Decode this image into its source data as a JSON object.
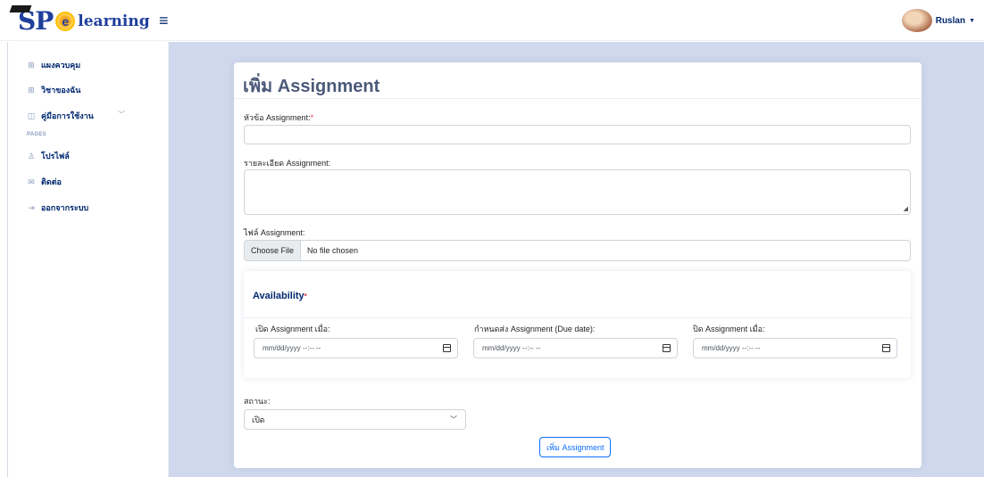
{
  "header": {
    "logo": {
      "sp": "SP",
      "sun": "e",
      "text": "learning"
    },
    "toggle_icon": "≡",
    "user_name": "Ruslan"
  },
  "sidebar": {
    "items": [
      {
        "label": "แผงควบคุม",
        "icon": "grid-icon"
      },
      {
        "label": "วิชาของฉัน",
        "icon": "grid-icon"
      },
      {
        "label": "คู่มือการใช้งาน",
        "icon": "book-icon",
        "has_chevron": true
      }
    ],
    "heading": "PAGES",
    "pages": [
      {
        "label": "โปรไฟล์",
        "icon": "person-icon"
      },
      {
        "label": "ติดต่อ",
        "icon": "envelope-icon"
      },
      {
        "label": "ออกจากระบบ",
        "icon": "logout-icon"
      }
    ]
  },
  "form": {
    "title": "เพิ่ม Assignment",
    "title_label": "หัวข้อ Assignment:",
    "required_mark": "*",
    "detail_label": "รายละเอียด Assignment:",
    "file_label": "ไฟล์ Assignment:",
    "file_button": "Choose File",
    "file_status": "No file chosen",
    "availability": {
      "title": "Availability",
      "required_mark": "*",
      "open_label": "เปิด Assignment เมื่อ:",
      "due_label": "กำหนดส่ง Assignment (Due date):",
      "close_label": "ปิด Assignment เมื่อ:",
      "date_placeholder": "mm/dd/yyyy --:-- --"
    },
    "status_label": "สถานะ:",
    "status_value": "เปิด",
    "submit_label": "เพิ่ม Assignment"
  },
  "colors": {
    "main_bg": "#cfd8ec",
    "primary": "#0d6efd",
    "brand": "#012970",
    "required": "#dc3545"
  }
}
